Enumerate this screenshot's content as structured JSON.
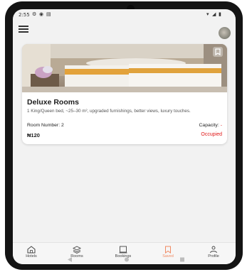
{
  "status_bar": {
    "time": "2:55"
  },
  "room": {
    "title": "Deluxe Rooms",
    "description": "1 King/Queen bed, ~25–30 m², upgraded furnishings, better views, luxury touches.",
    "room_number": "Room Number: 2",
    "capacity_label": "Capacity:",
    "capacity_value": "-",
    "price": "₦120",
    "status": "Occupied"
  },
  "nav": {
    "items": [
      {
        "label": "Hotels",
        "icon": "home-icon",
        "active": false
      },
      {
        "label": "Rooms",
        "icon": "layers-icon",
        "active": false
      },
      {
        "label": "Bookings",
        "icon": "bookings-icon",
        "active": false
      },
      {
        "label": "Saved",
        "icon": "bookmark-icon",
        "active": true
      },
      {
        "label": "Profile",
        "icon": "profile-icon",
        "active": false
      }
    ]
  },
  "colors": {
    "accent": "#f08a63",
    "status_red": "#e01515",
    "screen_bg": "#f2f2f2"
  }
}
